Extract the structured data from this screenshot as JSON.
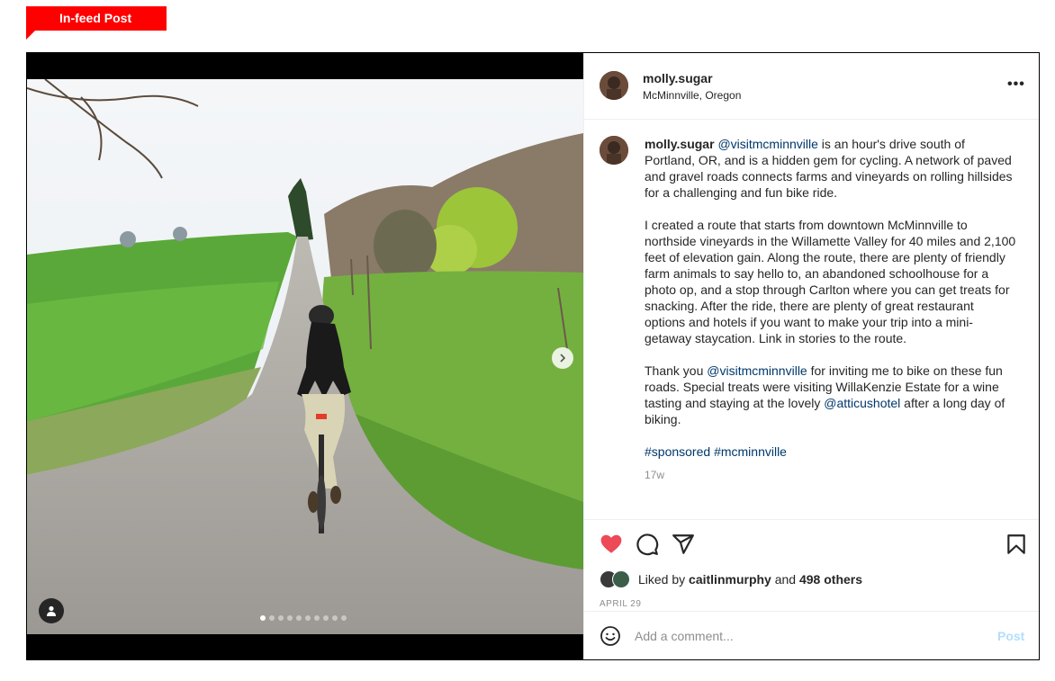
{
  "tag": {
    "label": "In-feed Post",
    "color": "#ff0000"
  },
  "post": {
    "username": "molly.sugar",
    "location": "McMinnville, Oregon",
    "more_icon": "more-horizontal-icon",
    "more_label": "•••",
    "caption": {
      "mention1": "@visitmcminnville",
      "para1_text": " is an hour's drive south of Portland, OR, and is a hidden gem for cycling. A network of paved and gravel roads connects farms and vineyards on rolling hillsides for a challenging and fun bike ride.",
      "para2": "I created a route that starts from downtown McMinnville to northside vineyards in the Willamette Valley for 40 miles and 2,100 feet of elevation gain. Along the route, there are plenty of friendly farm animals to say hello to, an abandoned schoolhouse for a photo op, and a stop through Carlton where you can get treats for snacking. After the ride, there are plenty of great restaurant options and hotels if you want to make your trip into a mini-getaway staycation. Link in stories to the route.",
      "para3_a": "Thank you ",
      "para3_mention": "@visitmcminnville",
      "para3_b": " for inviting me to bike on these fun roads. Special treats were visiting WillaKenzie Estate for a wine tasting and staying at the lovely ",
      "para3_mention2": "@atticushotel",
      "para3_c": " after a long day of biking.",
      "hashtag1": "#sponsored",
      "hashtag2": "#mcminnville",
      "time_ago": "17w"
    },
    "likes": {
      "prefix": "Liked by ",
      "user": "caitlinmurphy",
      "middle": " and ",
      "count": "498 others"
    },
    "date": "APRIL 29",
    "comment": {
      "placeholder": "Add a comment...",
      "post_label": "Post"
    },
    "carousel": {
      "slides": 10,
      "active_index": 0
    },
    "icons": {
      "like": "heart-filled-icon",
      "comment": "comment-bubble-icon",
      "share": "paper-plane-icon",
      "save": "bookmark-icon",
      "emoji": "smiley-icon",
      "next": "chevron-right-icon",
      "tagged": "person-icon"
    },
    "colors": {
      "like": "#ed4956",
      "link": "#00376b",
      "post_disabled": "#b2dffc",
      "muted": "#8e8e8e"
    }
  }
}
